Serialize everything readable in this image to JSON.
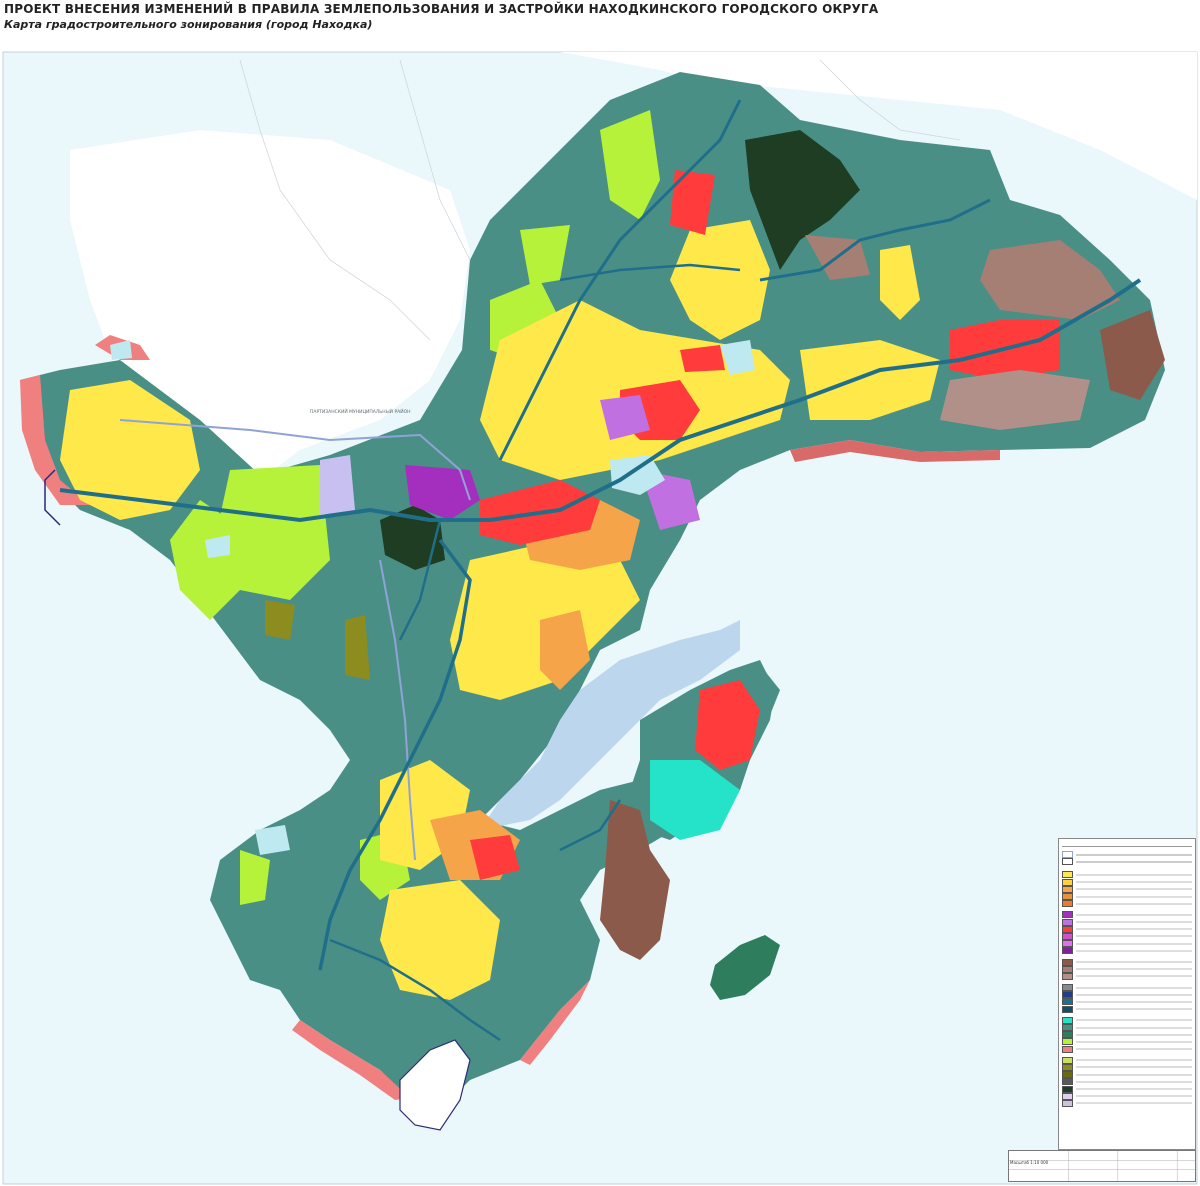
{
  "title": "ПРОЕКТ ВНЕСЕНИЯ ИЗМЕНЕНИЙ В ПРАВИЛА ЗЕМЛЕПОЛЬЗОВАНИЯ И ЗАСТРОЙКИ НАХОДКИНСКОГО ГОРОДСКОГО ОКРУГА",
  "subtitle": "Карта градостроительного зонирования (город Находка)",
  "place_labels": {
    "partizansky": "ПАРТИЗАНСКИЙ МУНИЦИПАЛЬНЫЙ РАЙОН"
  },
  "scale_text": "Масштаб 1:10 000",
  "colors": {
    "sea": "#e6f6fb",
    "base": "#4a8f86",
    "road": "#1f6f8a",
    "boundary": "#8fa3d6",
    "residential": "#ffe84a",
    "public": "#ff3b3b",
    "industrial": "#9b6f66",
    "recreation": "#b6f23a",
    "forest": "#1e3d22",
    "special": "#a42fbf",
    "coast": "#f08080",
    "lake": "#bfe9f1",
    "water_zone": "#25e3c8"
  }
}
